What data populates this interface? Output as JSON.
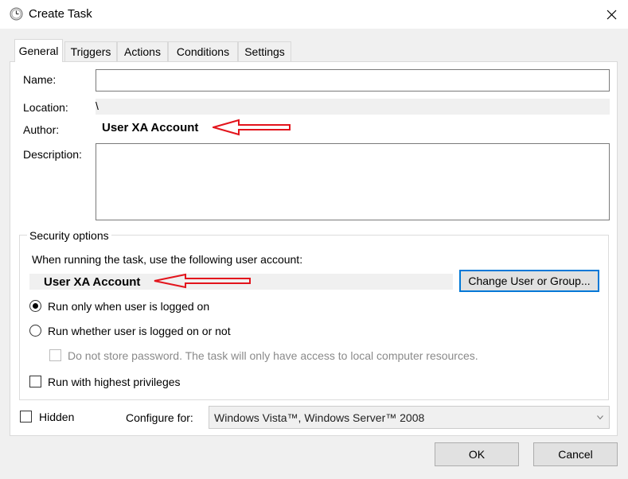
{
  "window": {
    "title": "Create Task"
  },
  "tabs": [
    {
      "label": "General"
    },
    {
      "label": "Triggers"
    },
    {
      "label": "Actions"
    },
    {
      "label": "Conditions"
    },
    {
      "label": "Settings"
    }
  ],
  "general": {
    "name_label": "Name:",
    "name_value": "",
    "location_label": "Location:",
    "location_value": "\\",
    "author_label": "Author:",
    "author_value": "User XA Account",
    "description_label": "Description:",
    "description_value": ""
  },
  "security": {
    "group_label": "Security options",
    "account_prompt": "When running the task, use the following user account:",
    "account_value": "User XA Account",
    "change_button": "Change User or Group...",
    "radio_logged_on": "Run only when user is logged on",
    "radio_logged_on_selected": true,
    "radio_whether": "Run whether user is logged on or not",
    "radio_whether_selected": false,
    "no_store_password": "Do not store password.  The task will only have access to local computer resources.",
    "highest_privileges": "Run with highest privileges"
  },
  "bottom": {
    "hidden_label": "Hidden",
    "configure_label": "Configure for:",
    "configure_value": "Windows Vista™, Windows Server™ 2008"
  },
  "buttons": {
    "ok": "OK",
    "cancel": "Cancel"
  },
  "annotation_arrow_color": "#e3141c"
}
